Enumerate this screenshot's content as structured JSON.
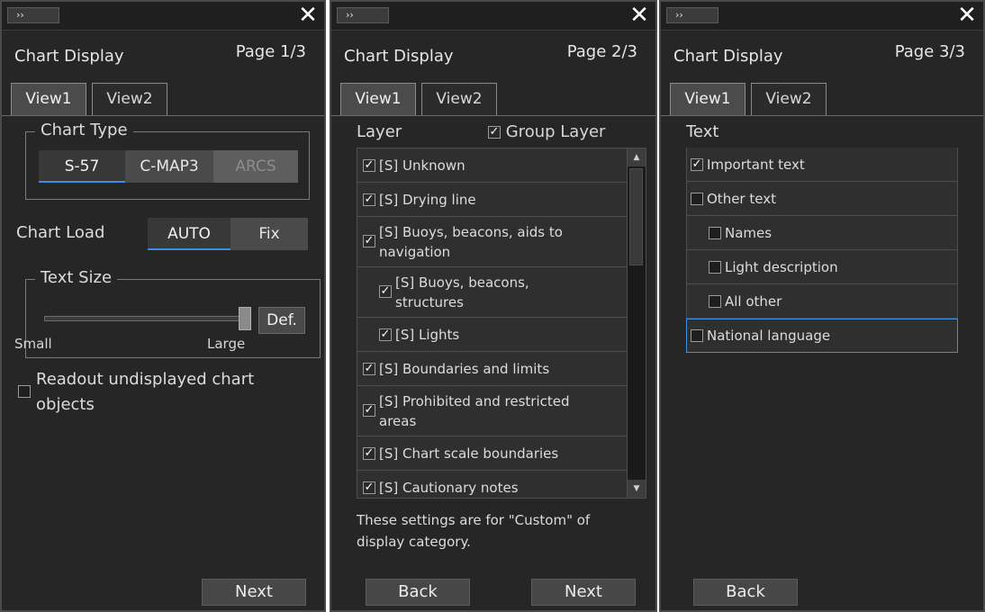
{
  "common": {
    "expand_glyph": "››",
    "close_glyph": "✕",
    "title": "Chart Display",
    "tabs": [
      "View1",
      "View2"
    ]
  },
  "panel1": {
    "page": "Page 1/3",
    "chart_type": {
      "label": "Chart Type",
      "options": [
        "S-57",
        "C-MAP3",
        "ARCS"
      ],
      "selected": "S-57",
      "disabled": "ARCS"
    },
    "chart_load": {
      "label": "Chart Load",
      "options": [
        "AUTO",
        "Fix"
      ],
      "selected": "AUTO"
    },
    "text_size": {
      "label": "Text Size",
      "default_button": "Def.",
      "min_label": "Small",
      "max_label": "Large",
      "value": 1.0
    },
    "readout": {
      "label_line1": "Readout undisplayed chart",
      "label_line2": "objects",
      "checked": false
    },
    "next_button": "Next"
  },
  "panel2": {
    "page": "Page 2/3",
    "layer_label": "Layer",
    "group_layer": {
      "label": "Group Layer",
      "checked": true
    },
    "items": [
      {
        "line1": "[S] Unknown",
        "line2": "",
        "checked": true,
        "indent": 0
      },
      {
        "line1": "[S] Drying line",
        "line2": "",
        "checked": true,
        "indent": 0
      },
      {
        "line1": "[S] Buoys, beacons, aids to",
        "line2": "navigation",
        "checked": true,
        "indent": 0
      },
      {
        "line1": "[S] Buoys, beacons,",
        "line2": "structures",
        "checked": true,
        "indent": 1
      },
      {
        "line1": "[S] Lights",
        "line2": "",
        "checked": true,
        "indent": 1
      },
      {
        "line1": "[S] Boundaries and limits",
        "line2": "",
        "checked": true,
        "indent": 0
      },
      {
        "line1": "[S] Prohibited and restricted",
        "line2": "areas",
        "checked": true,
        "indent": 0
      },
      {
        "line1": "[S] Chart scale boundaries",
        "line2": "",
        "checked": true,
        "indent": 0
      },
      {
        "line1": "[S] Cautionary notes",
        "line2": "",
        "checked": true,
        "indent": 0
      }
    ],
    "note_line1": "These settings are for \"Custom\" of",
    "note_line2": "display category.",
    "back_button": "Back",
    "next_button": "Next"
  },
  "panel3": {
    "page": "Page 3/3",
    "section_label": "Text",
    "items": [
      {
        "label": "Important text",
        "checked": true,
        "indent": 0
      },
      {
        "label": "Other text",
        "checked": false,
        "indent": 0
      },
      {
        "label": "Names",
        "checked": false,
        "indent": 1
      },
      {
        "label": "Light description",
        "checked": false,
        "indent": 1
      },
      {
        "label": "All other",
        "checked": false,
        "indent": 1
      },
      {
        "label": "National language",
        "checked": false,
        "indent": 0
      }
    ],
    "back_button": "Back"
  },
  "colors": {
    "panel_bg": "#262626",
    "accent_blue": "#3c8fe0",
    "text": "#dcdcdc"
  }
}
